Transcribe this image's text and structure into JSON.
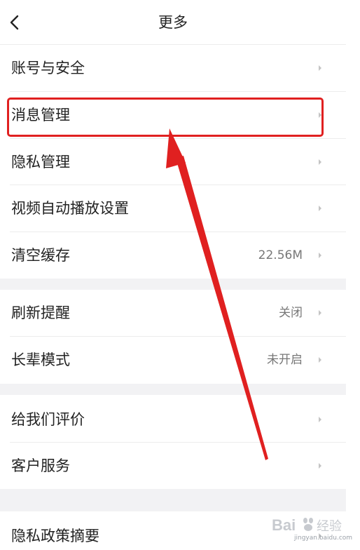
{
  "header": {
    "title": "更多",
    "back_icon": "chevron-left-icon"
  },
  "sections": [
    {
      "items": [
        {
          "label": "账号与安全",
          "value": ""
        },
        {
          "label": "消息管理",
          "value": ""
        },
        {
          "label": "隐私管理",
          "value": ""
        },
        {
          "label": "视频自动播放设置",
          "value": ""
        },
        {
          "label": "清空缓存",
          "value": "22.56M"
        }
      ]
    },
    {
      "items": [
        {
          "label": "刷新提醒",
          "value": "关闭"
        },
        {
          "label": "长辈模式",
          "value": "未开启"
        }
      ]
    },
    {
      "items": [
        {
          "label": "给我们评价",
          "value": ""
        },
        {
          "label": "客户服务",
          "value": ""
        }
      ]
    },
    {
      "items": [
        {
          "label": "隐私政策摘要",
          "value": ""
        }
      ]
    }
  ],
  "annotation": {
    "highlight_color": "#e02020",
    "arrow_color": "#e02020",
    "highlighted_item": "消息管理"
  },
  "watermark": {
    "brand": "Bai",
    "brand_suffix": "经验",
    "url": "jingyan.baidu.com"
  },
  "colors": {
    "text": "#222222",
    "secondary": "#777777",
    "chevron": "#c4c4c4",
    "section_gap": "#f2f2f4"
  }
}
